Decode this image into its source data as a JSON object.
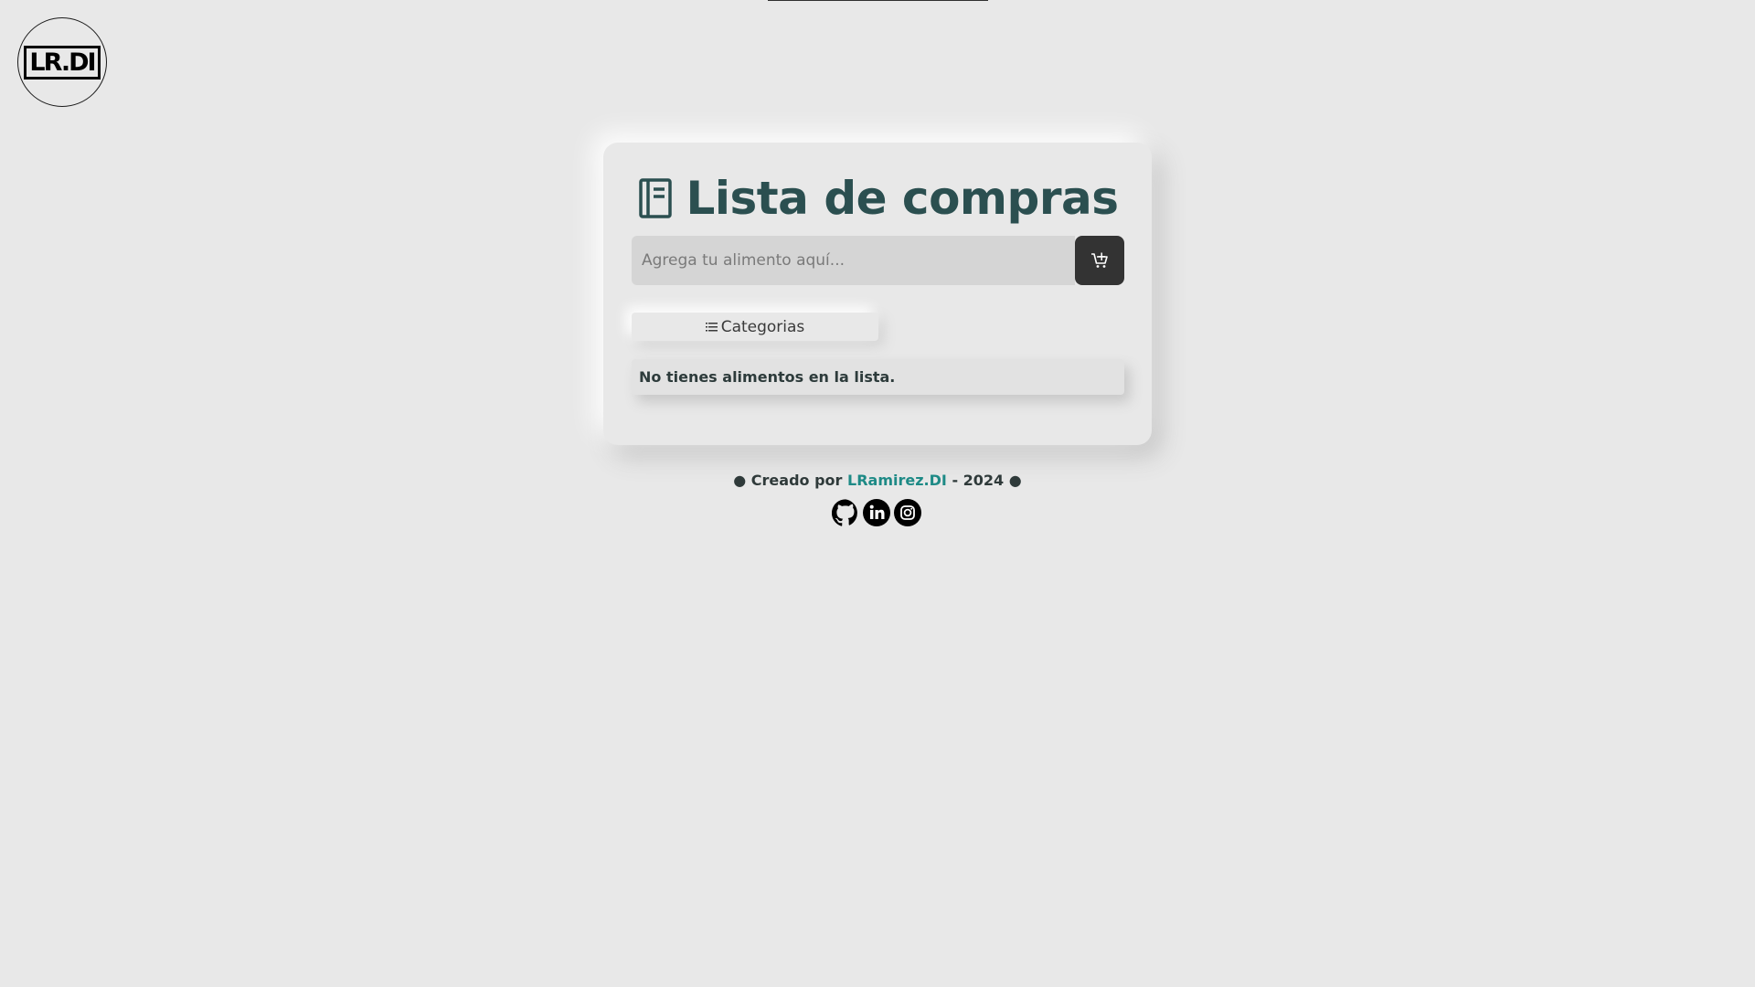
{
  "logo": {
    "text": "LR.DI"
  },
  "header": {
    "title": "Lista de compras",
    "title_icon": "notebook-icon"
  },
  "form": {
    "placeholder": "Agrega tu alimento aquí...",
    "add_icon": "cart-add-icon"
  },
  "categories": {
    "label": "Categorias",
    "icon": "list-icon"
  },
  "list": {
    "empty_message": "No tienes alimentos en la lista."
  },
  "footer": {
    "prefix": "● Creado por",
    "author": "LRamirez.DI",
    "suffix": "- 2024 ●",
    "socials": [
      "github-icon",
      "linkedin-icon",
      "instagram-icon"
    ]
  },
  "colors": {
    "background": "#e8e8e8",
    "title": "#2b4f50",
    "author_link": "#1e8a86",
    "button_dark": "#333333"
  }
}
